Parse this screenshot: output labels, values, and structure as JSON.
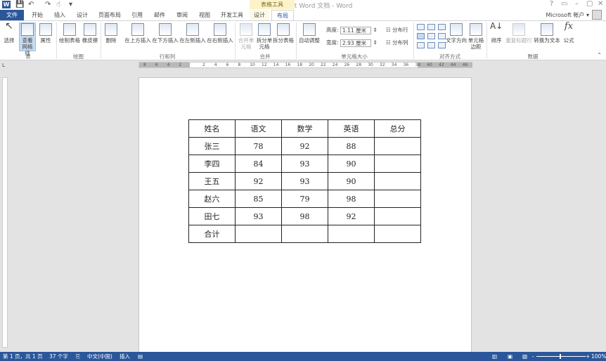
{
  "title": "新建 Microsoft Word 文档 - Word",
  "context_tab": "表格工具",
  "window_controls": {
    "help": "?",
    "restore_ribbon": "▭",
    "minimize": "–",
    "maximize": "▢",
    "close": "✕"
  },
  "account": "Microsoft 帐户 ▾",
  "tabs": [
    "文件",
    "开始",
    "插入",
    "设计",
    "页面布局",
    "引用",
    "邮件",
    "审阅",
    "视图",
    "开发工具",
    "设计",
    "布局"
  ],
  "active_tab": "布局",
  "ribbon": {
    "groups": [
      "表",
      "绘图",
      "行和列",
      "合并",
      "单元格大小",
      "对齐方式",
      "数据"
    ],
    "buttons": {
      "select": "选择",
      "gridlines": "查看网格线",
      "properties": "属性",
      "draw_table": "绘制表格",
      "eraser": "橡皮擦",
      "delete": "删除",
      "insert_above": "在上方插入",
      "insert_below": "在下方插入",
      "insert_left": "在左侧插入",
      "insert_right": "在右侧插入",
      "merge": "合并单元格",
      "split_cells": "拆分单元格",
      "split_table": "拆分表格",
      "autofit": "自动调整",
      "text_direction": "文字方向",
      "cell_margins": "单元格边距",
      "sort": "排序",
      "repeat_header": "重复标题行",
      "convert_text": "转换为文本",
      "formula": "公式",
      "distribute_rows": "分布行",
      "distribute_cols": "分布列"
    },
    "height_label": "高度:",
    "height_value": "1.11 厘米",
    "width_label": "宽度:",
    "width_value": "2.93 厘米"
  },
  "ruler": [
    "8",
    "6",
    "4",
    "2",
    "",
    "2",
    "4",
    "6",
    "8",
    "10",
    "12",
    "14",
    "16",
    "18",
    "20",
    "22",
    "24",
    "26",
    "28",
    "30",
    "32",
    "34",
    "36",
    "38",
    "40",
    "42",
    "44",
    "46"
  ],
  "table": {
    "header": [
      "姓名",
      "语文",
      "数学",
      "英语",
      "总分"
    ],
    "rows": [
      [
        "张三",
        "78",
        "92",
        "88",
        ""
      ],
      [
        "李四",
        "84",
        "93",
        "90",
        ""
      ],
      [
        "王五",
        "92",
        "93",
        "90",
        ""
      ],
      [
        "赵六",
        "85",
        "79",
        "98",
        ""
      ],
      [
        "田七",
        "93",
        "98",
        "92",
        ""
      ],
      [
        "合计",
        "",
        "",
        "",
        ""
      ]
    ]
  },
  "status": {
    "page": "第 1 页，共 1 页",
    "words": "37 个字",
    "language": "中文(中国)",
    "mode": "插入",
    "zoom": "100%",
    "zoom_percent": 100
  },
  "colors": {
    "accent": "#2b579a",
    "context": "#fdf3c8"
  }
}
